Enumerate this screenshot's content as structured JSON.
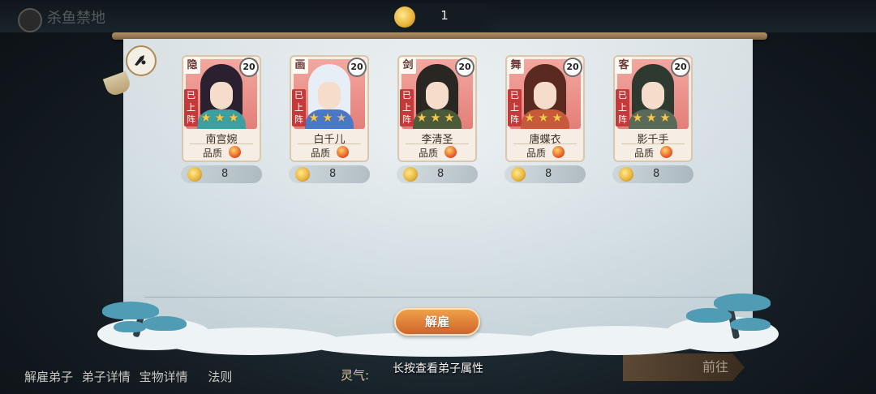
{
  "background": {
    "title": "杀鱼禁地",
    "bottom_links": [
      "解雇弟子",
      "弟子详情",
      "宝物详情",
      "法则"
    ],
    "qi_label": "灵气:",
    "go_button": "前往"
  },
  "currency": {
    "icon": "fire-coin-icon",
    "value": "1"
  },
  "cards": [
    {
      "name": "南宫婉",
      "class": "隐",
      "level": "20",
      "status": "已上阵",
      "stars": 3,
      "stars_total": 3,
      "quality_label": "品质",
      "cost": "8",
      "hair": "#2a2030",
      "outfit": "#3aa0a0"
    },
    {
      "name": "白千儿",
      "class": "画",
      "level": "20",
      "status": "已上阵",
      "stars": 2,
      "stars_total": 3,
      "quality_label": "品质",
      "cost": "8",
      "hair": "#e8eef5",
      "outfit": "#4a78c8"
    },
    {
      "name": "李清圣",
      "class": "剑",
      "level": "20",
      "status": "已上阵",
      "stars": 3,
      "stars_total": 3,
      "quality_label": "品质",
      "cost": "8",
      "hair": "#2a2622",
      "outfit": "#4a5a3a"
    },
    {
      "name": "唐蝶衣",
      "class": "舞",
      "level": "20",
      "status": "已上阵",
      "stars": 3,
      "stars_total": 3,
      "quality_label": "品质",
      "cost": "8",
      "hair": "#5a2a20",
      "outfit": "#c85a3a"
    },
    {
      "name": "影千手",
      "class": "客",
      "level": "20",
      "status": "已上阵",
      "stars": 3,
      "stars_total": 3,
      "quality_label": "品质",
      "cost": "8",
      "hair": "#2e3a30",
      "outfit": "#5a6a5a"
    }
  ],
  "dismiss_button": "解雇",
  "hint": "长按查看弟子属性"
}
